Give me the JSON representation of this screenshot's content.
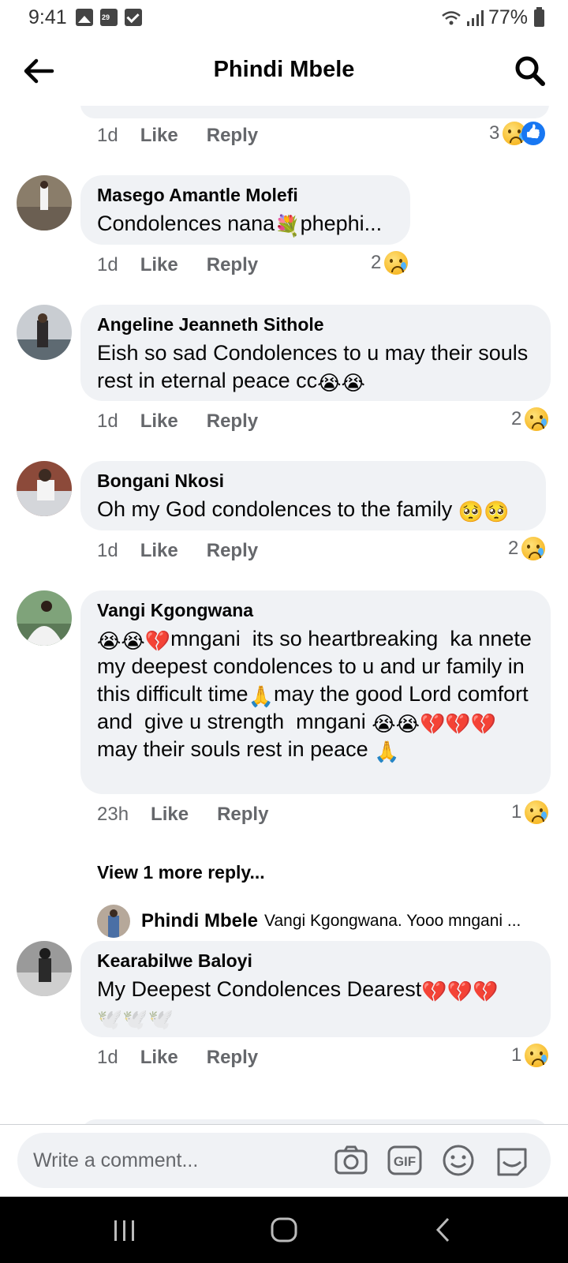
{
  "status_bar": {
    "time": "9:41",
    "battery": "77%"
  },
  "header": {
    "title": "Phindi Mbele"
  },
  "top_comment": {
    "time": "1d",
    "like": "Like",
    "reply": "Reply",
    "reactions": "3"
  },
  "comments": [
    {
      "author": "Masego Amantle Molefi",
      "text_before": "Condolences nana",
      "emoji_mid": "💐",
      "text_after": "phephi...",
      "time": "1d",
      "like": "Like",
      "reply": "Reply",
      "reactions": "2"
    },
    {
      "author": "Angeline Jeanneth Sithole",
      "text": "Eish so sad Condolences to u may their souls rest in eternal peace cc",
      "emoji_end": "😭😭",
      "time": "1d",
      "like": "Like",
      "reply": "Reply",
      "reactions": "2"
    },
    {
      "author": "Bongani Nkosi",
      "text": "Oh my God condolences to the family ",
      "emoji_end": "🥺🥺",
      "time": "1d",
      "like": "Like",
      "reply": "Reply",
      "reactions": "2"
    },
    {
      "author": "Vangi Kgongwana",
      "emoji_start": "😭😭💔",
      "text1": "mngani  its so heartbreaking  ka nnete my deepest condolences to u and ur family in this difficult time",
      "emoji_mid1": "🙏",
      "text2": "may the good Lord comfort and  give u strength  mngani ",
      "emoji_mid2": "😭😭💔💔💔",
      "text3": "may their souls rest in peace ",
      "emoji_end": "🙏",
      "time": "23h",
      "like": "Like",
      "reply": "Reply",
      "reactions": "1"
    },
    {
      "author": "Kearabilwe Baloyi",
      "text": "My Deepest Condolences Dearest",
      "emoji_end": "💔💔💔",
      "emoji_line2": "🕊️🕊️🕊️",
      "time": "1d",
      "like": "Like",
      "reply": "Reply",
      "reactions": "1"
    }
  ],
  "view_more": "View 1 more reply...",
  "nested_reply": {
    "author": "Phindi Mbele",
    "text": "Vangi Kgongwana. Yooo mngani ..."
  },
  "composer": {
    "placeholder": "Write a comment..."
  },
  "icons": {
    "back": "arrow-left-icon",
    "search": "search-icon",
    "camera": "camera-icon",
    "gif": "gif-icon",
    "emoji": "smiley-icon",
    "sticker": "sticker-icon"
  },
  "colors": {
    "bubble": "#f0f2f5",
    "meta": "#65676b",
    "like_blue": "#1877f2",
    "nav": "#000000"
  }
}
